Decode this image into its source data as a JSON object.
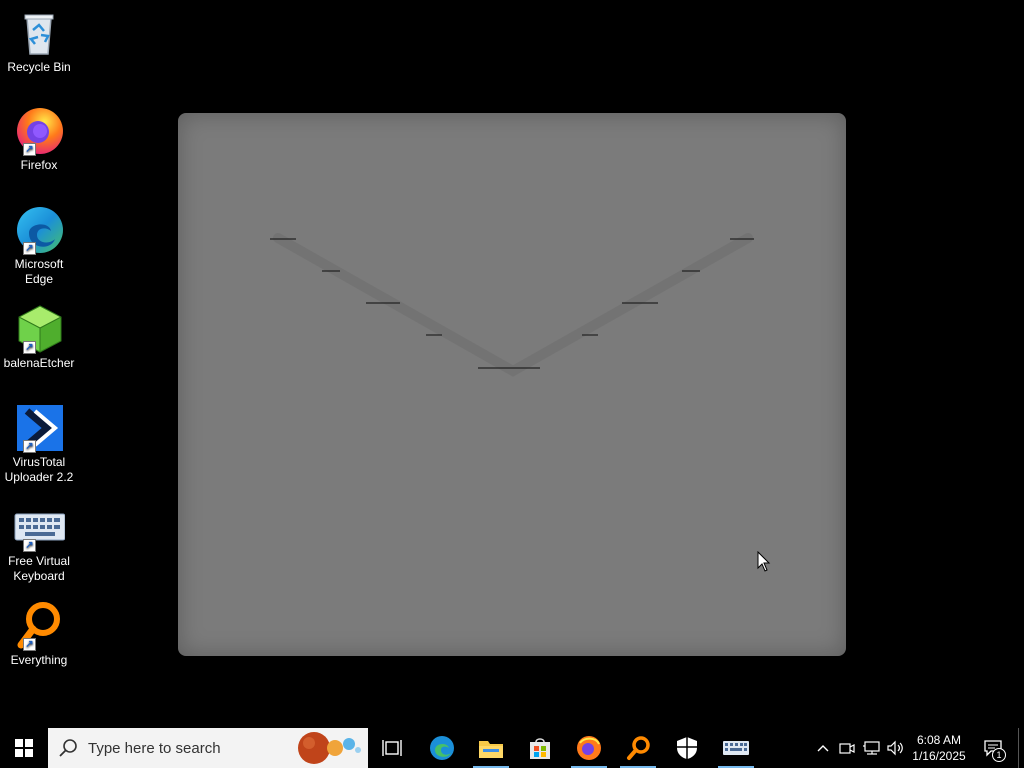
{
  "desktop": {
    "icons": [
      {
        "label_line1": "Recycle Bin",
        "label_line2": ""
      },
      {
        "label_line1": "Firefox",
        "label_line2": ""
      },
      {
        "label_line1": "Microsoft",
        "label_line2": "Edge"
      },
      {
        "label_line1": "balenaEtcher",
        "label_line2": ""
      },
      {
        "label_line1": "VirusTotal",
        "label_line2": "Uploader 2.2"
      },
      {
        "label_line1": "Free Virtual",
        "label_line2": "Keyboard"
      },
      {
        "label_line1": "Everything",
        "label_line2": ""
      }
    ]
  },
  "taskbar": {
    "search_placeholder": "Type here to search",
    "clock_time": "6:08 AM",
    "clock_date": "1/16/2025",
    "notification_count": "1"
  },
  "colors": {
    "taskbar_bg": "#000000",
    "window_gray": "#7b7b7b",
    "accent": "#76b9ed"
  }
}
